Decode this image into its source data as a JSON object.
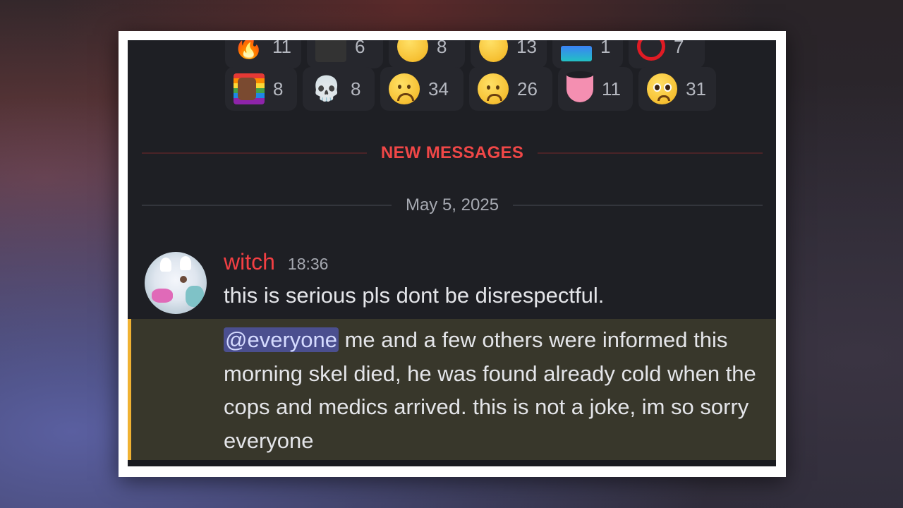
{
  "reactions_top_row": [
    {
      "icon": "fire-emoji-icon",
      "count": "11"
    },
    {
      "icon": "sticker-emoji-icon",
      "count": "6"
    },
    {
      "icon": "smiling-face-emoji-icon",
      "count": "8"
    },
    {
      "icon": "relieved-face-emoji-icon",
      "count": "13"
    },
    {
      "icon": "flag-emoji-icon",
      "count": "1"
    },
    {
      "icon": "red-circle-emoji-icon",
      "count": "7"
    }
  ],
  "reactions": [
    {
      "icon": "pride-flag-emoji-icon",
      "glyph": "",
      "count": "8"
    },
    {
      "icon": "skull-emoji-icon",
      "glyph": "💀",
      "count": "8"
    },
    {
      "icon": "sad-face-emoji-icon",
      "glyph": "",
      "count": "34"
    },
    {
      "icon": "worried-face-emoji-icon",
      "glyph": "",
      "count": "26"
    },
    {
      "icon": "tongue-emoji-icon",
      "glyph": "",
      "count": "11"
    },
    {
      "icon": "pleading-face-emoji-icon",
      "glyph": "",
      "count": "31"
    }
  ],
  "dividers": {
    "new_messages": "NEW MESSAGES",
    "date": "May 5, 2025"
  },
  "message": {
    "username": "witch",
    "timestamp": "18:36",
    "text": "this is serious pls dont be disrespectful.",
    "mention": "@everyone",
    "mention_text": " me and a few others were informed this morning skel died, he was found already cold when the cops and medics arrived. this is not a joke, im so sorry everyone"
  },
  "colors": {
    "username": "#f23f43",
    "new_messages": "#f04747",
    "mention_bar": "#f0b232",
    "mention_bg": "#38372b",
    "mention_pill": "#4b4f8f"
  }
}
